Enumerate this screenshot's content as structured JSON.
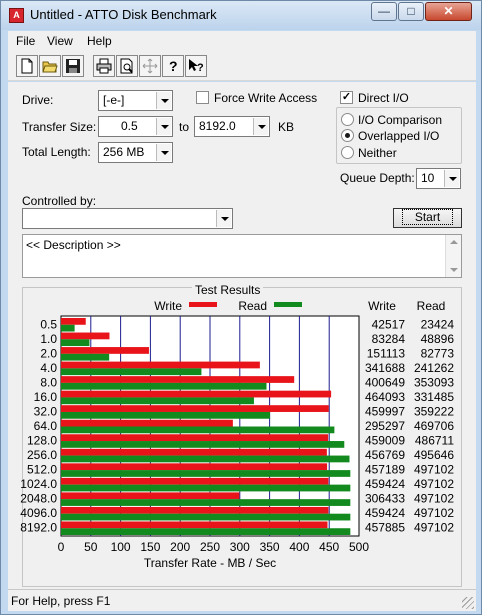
{
  "window": {
    "title": "Untitled - ATTO Disk Benchmark",
    "app_icon_text": "A"
  },
  "menu": [
    "File",
    "View",
    "Help"
  ],
  "toolbar": {
    "buttons": [
      "new-icon",
      "open-icon",
      "save-icon",
      "print-icon",
      "print-preview-icon",
      "move-icon",
      "help-icon",
      "context-help-icon"
    ]
  },
  "settings": {
    "drive_label": "Drive:",
    "drive_value": "[-e-]",
    "force_write_label": "Force Write Access",
    "force_write_checked": false,
    "direct_io_label": "Direct I/O",
    "direct_io_checked": true,
    "transfer_size_label": "Transfer Size:",
    "transfer_from": "0.5",
    "to_label": "to",
    "transfer_to": "8192.0",
    "kb_label": "KB",
    "total_length_label": "Total Length:",
    "total_length_value": "256 MB",
    "io_options": [
      "I/O Comparison",
      "Overlapped I/O",
      "Neither"
    ],
    "io_selected": "Overlapped I/O",
    "queue_depth_label": "Queue Depth:",
    "queue_depth_value": "10",
    "controlled_by_label": "Controlled by:",
    "controlled_by_value": "",
    "start_label": "Start",
    "description_text": "<< Description >>"
  },
  "results_title": "Test Results",
  "status_text": "For Help, press F1",
  "colors": {
    "write": "#e8141a",
    "read": "#138a1e",
    "grid": "#1d1d8f"
  },
  "chart_data": {
    "type": "bar",
    "orientation": "horizontal",
    "categories": [
      "0.5",
      "1.0",
      "2.0",
      "4.0",
      "8.0",
      "16.0",
      "32.0",
      "64.0",
      "128.0",
      "256.0",
      "512.0",
      "1024.0",
      "2048.0",
      "4096.0",
      "8192.0"
    ],
    "series": [
      {
        "name": "Write",
        "values": [
          42517,
          83284,
          151113,
          341688,
          400649,
          464093,
          459997,
          295297,
          459009,
          456769,
          457189,
          459424,
          306433,
          459424,
          457885
        ]
      },
      {
        "name": "Read",
        "values": [
          23424,
          48896,
          82773,
          241262,
          353093,
          331485,
          359222,
          469706,
          486711,
          495646,
          497102,
          497102,
          497102,
          497102,
          497102
        ]
      }
    ],
    "column_headers": [
      "Write",
      "Read"
    ],
    "xlabel": "Transfer Rate - MB / Sec",
    "xticks": [
      "0",
      "50",
      "100",
      "150",
      "200",
      "250",
      "300",
      "350",
      "400",
      "450",
      "500"
    ],
    "xlim": [
      0,
      500
    ],
    "grid": true,
    "legend_position": "top"
  }
}
